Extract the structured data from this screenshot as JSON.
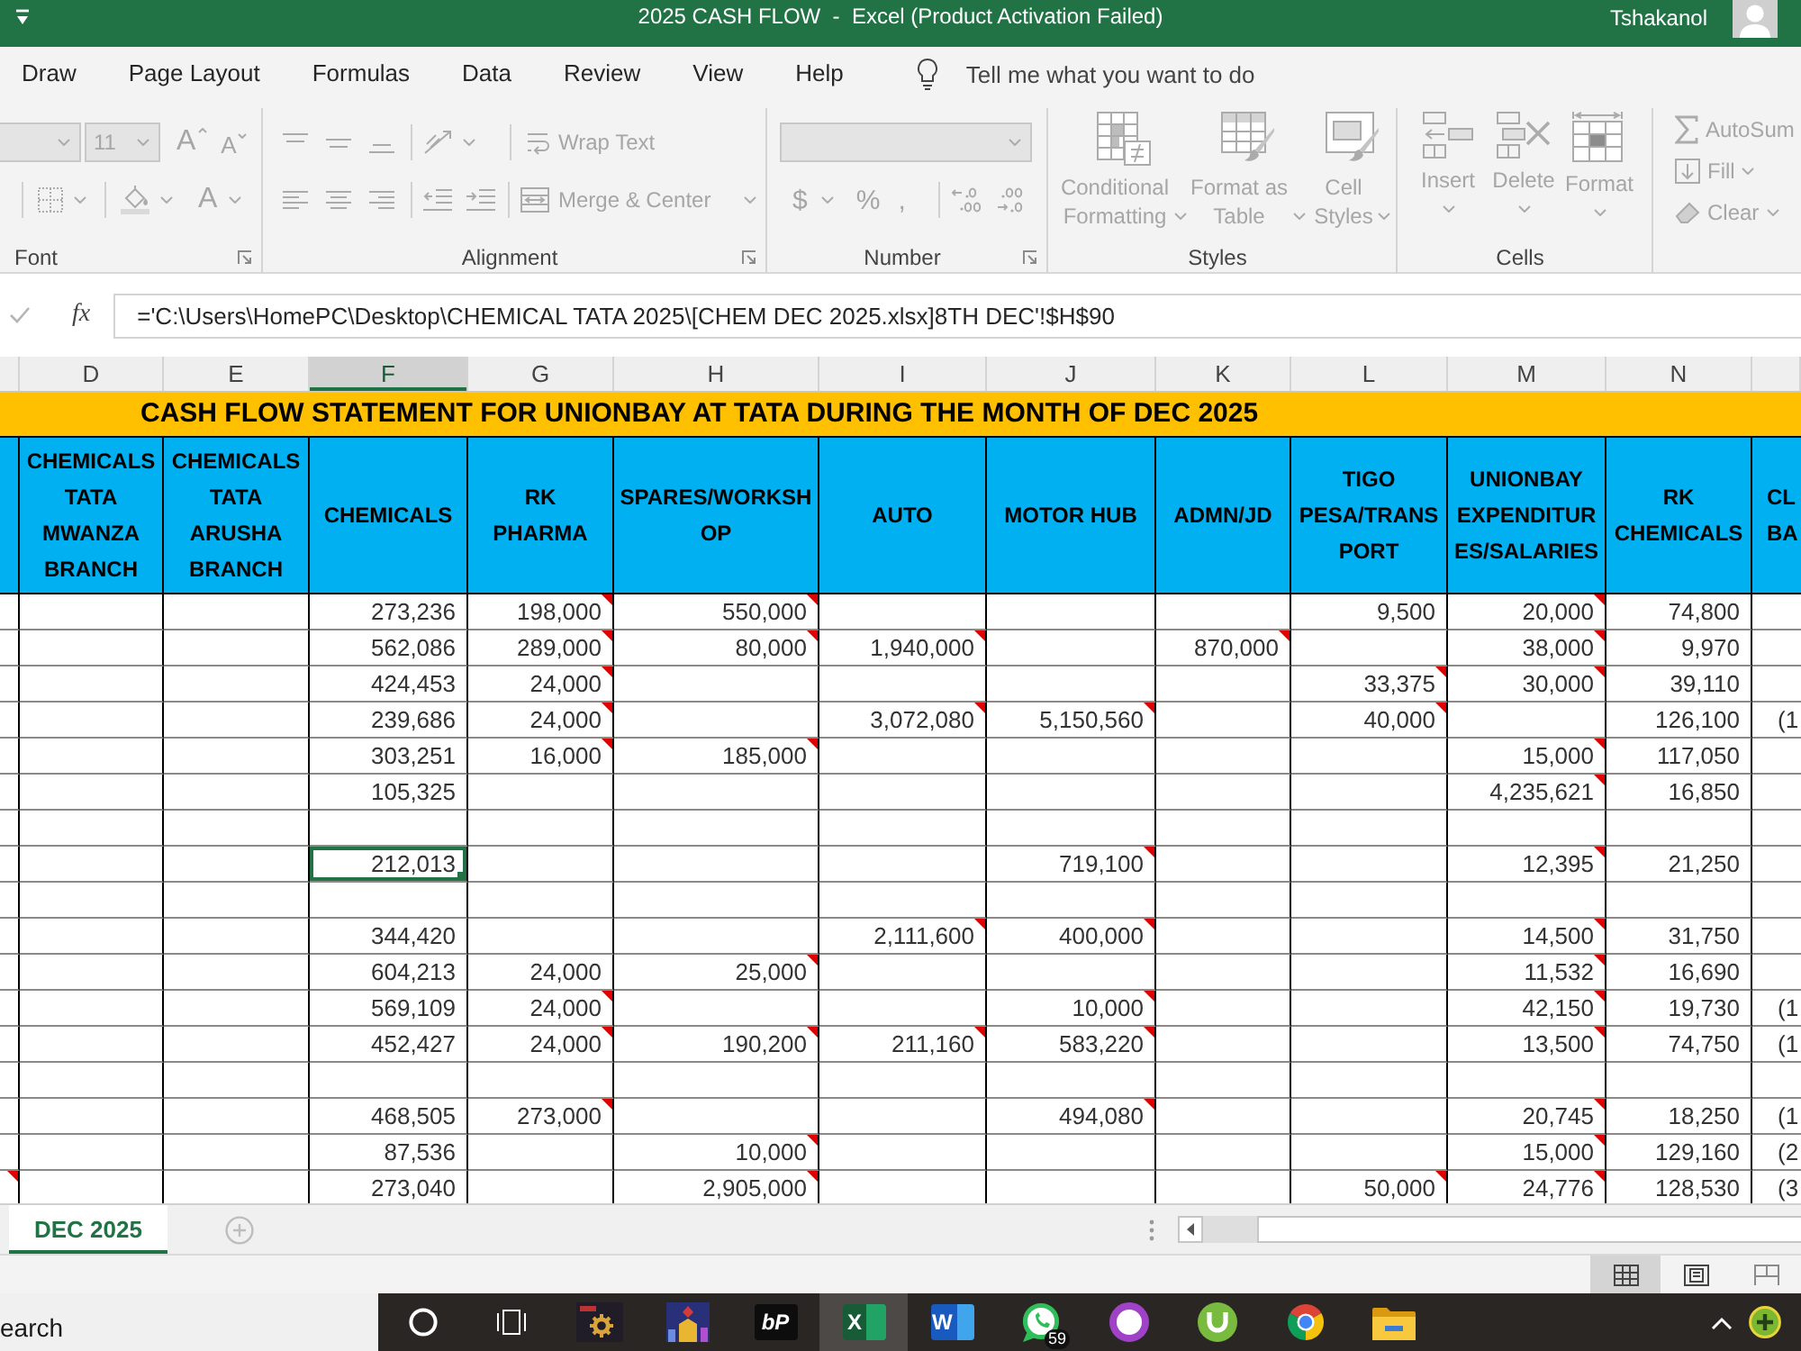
{
  "title_bar": {
    "title": "2025 CASH FLOW  -  Excel (Product Activation Failed)",
    "user": "Tshakanol"
  },
  "menu_tabs": [
    {
      "label": "Draw",
      "selected": false
    },
    {
      "label": "Page Layout",
      "selected": false
    },
    {
      "label": "Formulas",
      "selected": false
    },
    {
      "label": "Data",
      "selected": false
    },
    {
      "label": "Review",
      "selected": false
    },
    {
      "label": "View",
      "selected": false
    },
    {
      "label": "Help",
      "selected": false
    }
  ],
  "tell_me": {
    "placeholder": "Tell me what you want to do"
  },
  "ribbon": {
    "disabled": true,
    "groups": [
      {
        "kind": "font",
        "label": "Font",
        "font_size": "11",
        "grow_font": "A",
        "shrink_font": "A",
        "font_color": "A"
      },
      {
        "kind": "alignment",
        "label": "Alignment",
        "wrap_text": "Wrap Text",
        "merge": "Merge & Center"
      },
      {
        "kind": "number",
        "label": "Number",
        "currency": "$",
        "percent": "%",
        "comma": ","
      },
      {
        "kind": "styles",
        "label": "Styles",
        "commands": [
          "Conditional\nFormatting",
          "Format as\nTable",
          "Cell\nStyles"
        ]
      },
      {
        "kind": "cells",
        "label": "Cells",
        "commands": [
          "Insert",
          "Delete",
          "Format"
        ]
      },
      {
        "kind": "editing",
        "commands": [
          "AutoSum",
          "Fill",
          "Clear"
        ]
      }
    ]
  },
  "formula_bar": {
    "function_button": "fx",
    "formula": "='C:\\Users\\HomePC\\Desktop\\CHEMICAL TATA 2025\\[CHEM DEC 2025.xlsx]8TH DEC'!$H$90"
  },
  "sheet": {
    "columns": [
      {
        "selected": false
      },
      {
        "letter": "D",
        "heading": "CHEMICALS\nTATA\nMWANZA\nBRANCH",
        "selected": false
      },
      {
        "letter": "E",
        "heading": "CHEMICALS\nTATA\nARUSHA\nBRANCH",
        "selected": false
      },
      {
        "letter": "F",
        "heading": "CHEMICALS",
        "selected": true
      },
      {
        "letter": "G",
        "heading": "RK\nPHARMA",
        "selected": false
      },
      {
        "letter": "H",
        "heading": "SPARES/WORKSH\nOP",
        "selected": false
      },
      {
        "letter": "I",
        "heading": "AUTO",
        "selected": false
      },
      {
        "letter": "J",
        "heading": "MOTOR HUB",
        "selected": false
      },
      {
        "letter": "K",
        "heading": "ADMN/JD",
        "selected": false
      },
      {
        "letter": "L",
        "heading": "TIGO\nPESA/TRANS\nPORT",
        "selected": false
      },
      {
        "letter": "M",
        "heading": "UNIONBAY\nEXPENDITUR\nES/SALARIES",
        "selected": false
      },
      {
        "letter": "N",
        "heading": "RK\nCHEMICALS",
        "selected": false
      },
      {
        "heading": "CL\nBA",
        "selected": false
      }
    ],
    "title": "CASH FLOW STATEMENT FOR UNIONBAY AT TATA DURING THE MONTH OF DEC 2025",
    "rows": [
      {
        "cells": [
          {
            "comment": false,
            "selected": false
          },
          {
            "comment": false,
            "selected": false
          },
          {
            "comment": false,
            "selected": false
          },
          {
            "value": "273,236",
            "comment": false,
            "selected": false
          },
          {
            "value": "198,000",
            "comment": true,
            "selected": false
          },
          {
            "value": "550,000",
            "comment": true,
            "selected": false
          },
          {
            "comment": false,
            "selected": false
          },
          {
            "comment": false,
            "selected": false
          },
          {
            "comment": false,
            "selected": false
          },
          {
            "value": "9,500",
            "comment": false,
            "selected": false
          },
          {
            "value": "20,000",
            "comment": true,
            "selected": false
          },
          {
            "value": "74,800",
            "comment": false,
            "selected": false
          },
          {
            "comment": false,
            "selected": false
          }
        ]
      },
      {
        "cells": [
          {
            "comment": false,
            "selected": false
          },
          {
            "comment": false,
            "selected": false
          },
          {
            "comment": false,
            "selected": false
          },
          {
            "value": "562,086",
            "comment": false,
            "selected": false
          },
          {
            "value": "289,000",
            "comment": true,
            "selected": false
          },
          {
            "value": "80,000",
            "comment": true,
            "selected": false
          },
          {
            "value": "1,940,000",
            "comment": true,
            "selected": false
          },
          {
            "comment": false,
            "selected": false
          },
          {
            "value": "870,000",
            "comment": true,
            "selected": false
          },
          {
            "comment": false,
            "selected": false
          },
          {
            "value": "38,000",
            "comment": true,
            "selected": false
          },
          {
            "value": "9,970",
            "comment": false,
            "selected": false
          },
          {
            "comment": false,
            "selected": false
          }
        ]
      },
      {
        "cells": [
          {
            "comment": false,
            "selected": false
          },
          {
            "comment": false,
            "selected": false
          },
          {
            "comment": false,
            "selected": false
          },
          {
            "value": "424,453",
            "comment": false,
            "selected": false
          },
          {
            "value": "24,000",
            "comment": true,
            "selected": false
          },
          {
            "comment": false,
            "selected": false
          },
          {
            "comment": false,
            "selected": false
          },
          {
            "comment": false,
            "selected": false
          },
          {
            "comment": false,
            "selected": false
          },
          {
            "value": "33,375",
            "comment": true,
            "selected": false
          },
          {
            "value": "30,000",
            "comment": true,
            "selected": false
          },
          {
            "value": "39,110",
            "comment": false,
            "selected": false
          },
          {
            "comment": false,
            "selected": false
          }
        ]
      },
      {
        "cells": [
          {
            "comment": false,
            "selected": false
          },
          {
            "comment": false,
            "selected": false
          },
          {
            "comment": false,
            "selected": false
          },
          {
            "value": "239,686",
            "comment": false,
            "selected": false
          },
          {
            "value": "24,000",
            "comment": true,
            "selected": false
          },
          {
            "comment": false,
            "selected": false
          },
          {
            "value": "3,072,080",
            "comment": true,
            "selected": false
          },
          {
            "value": "5,150,560",
            "comment": true,
            "selected": false
          },
          {
            "comment": false,
            "selected": false
          },
          {
            "value": "40,000",
            "comment": true,
            "selected": false
          },
          {
            "comment": false,
            "selected": false
          },
          {
            "value": "126,100",
            "comment": false,
            "selected": false
          },
          {
            "value": "(1",
            "comment": false,
            "selected": false
          }
        ]
      },
      {
        "cells": [
          {
            "comment": false,
            "selected": false
          },
          {
            "comment": false,
            "selected": false
          },
          {
            "comment": false,
            "selected": false
          },
          {
            "value": "303,251",
            "comment": false,
            "selected": false
          },
          {
            "value": "16,000",
            "comment": true,
            "selected": false
          },
          {
            "value": "185,000",
            "comment": true,
            "selected": false
          },
          {
            "comment": false,
            "selected": false
          },
          {
            "comment": false,
            "selected": false
          },
          {
            "comment": false,
            "selected": false
          },
          {
            "comment": false,
            "selected": false
          },
          {
            "value": "15,000",
            "comment": true,
            "selected": false
          },
          {
            "value": "117,050",
            "comment": false,
            "selected": false
          },
          {
            "comment": false,
            "selected": false
          }
        ]
      },
      {
        "cells": [
          {
            "comment": false,
            "selected": false
          },
          {
            "comment": false,
            "selected": false
          },
          {
            "comment": false,
            "selected": false
          },
          {
            "value": "105,325",
            "comment": false,
            "selected": false
          },
          {
            "comment": false,
            "selected": false
          },
          {
            "comment": false,
            "selected": false
          },
          {
            "comment": false,
            "selected": false
          },
          {
            "comment": false,
            "selected": false
          },
          {
            "comment": false,
            "selected": false
          },
          {
            "comment": false,
            "selected": false
          },
          {
            "value": "4,235,621",
            "comment": true,
            "selected": false
          },
          {
            "value": "16,850",
            "comment": false,
            "selected": false
          },
          {
            "comment": false,
            "selected": false
          }
        ]
      },
      {
        "cells": [
          {
            "comment": false,
            "selected": false
          },
          {
            "comment": false,
            "selected": false
          },
          {
            "comment": false,
            "selected": false
          },
          {
            "comment": false,
            "selected": false
          },
          {
            "comment": false,
            "selected": false
          },
          {
            "comment": false,
            "selected": false
          },
          {
            "comment": false,
            "selected": false
          },
          {
            "comment": false,
            "selected": false
          },
          {
            "comment": false,
            "selected": false
          },
          {
            "comment": false,
            "selected": false
          },
          {
            "comment": false,
            "selected": false
          },
          {
            "comment": false,
            "selected": false
          },
          {
            "comment": false,
            "selected": false
          }
        ]
      },
      {
        "cells": [
          {
            "comment": false,
            "selected": false
          },
          {
            "comment": false,
            "selected": false
          },
          {
            "comment": false,
            "selected": false
          },
          {
            "value": "212,013",
            "comment": false,
            "selected": true
          },
          {
            "comment": false,
            "selected": false
          },
          {
            "comment": false,
            "selected": false
          },
          {
            "comment": false,
            "selected": false
          },
          {
            "value": "719,100",
            "comment": true,
            "selected": false
          },
          {
            "comment": false,
            "selected": false
          },
          {
            "comment": false,
            "selected": false
          },
          {
            "value": "12,395",
            "comment": true,
            "selected": false
          },
          {
            "value": "21,250",
            "comment": false,
            "selected": false
          },
          {
            "comment": false,
            "selected": false
          }
        ]
      },
      {
        "cells": [
          {
            "comment": false,
            "selected": false
          },
          {
            "comment": false,
            "selected": false
          },
          {
            "comment": false,
            "selected": false
          },
          {
            "comment": false,
            "selected": false
          },
          {
            "comment": false,
            "selected": false
          },
          {
            "comment": false,
            "selected": false
          },
          {
            "comment": false,
            "selected": false
          },
          {
            "comment": false,
            "selected": false
          },
          {
            "comment": false,
            "selected": false
          },
          {
            "comment": false,
            "selected": false
          },
          {
            "comment": false,
            "selected": false
          },
          {
            "comment": false,
            "selected": false
          },
          {
            "comment": false,
            "selected": false
          }
        ]
      },
      {
        "cells": [
          {
            "comment": false,
            "selected": false
          },
          {
            "comment": false,
            "selected": false
          },
          {
            "comment": false,
            "selected": false
          },
          {
            "value": "344,420",
            "comment": false,
            "selected": false
          },
          {
            "comment": false,
            "selected": false
          },
          {
            "comment": false,
            "selected": false
          },
          {
            "value": "2,111,600",
            "comment": true,
            "selected": false
          },
          {
            "value": "400,000",
            "comment": true,
            "selected": false
          },
          {
            "comment": false,
            "selected": false
          },
          {
            "comment": false,
            "selected": false
          },
          {
            "value": "14,500",
            "comment": true,
            "selected": false
          },
          {
            "value": "31,750",
            "comment": false,
            "selected": false
          },
          {
            "comment": false,
            "selected": false
          }
        ]
      },
      {
        "cells": [
          {
            "comment": false,
            "selected": false
          },
          {
            "comment": false,
            "selected": false
          },
          {
            "comment": false,
            "selected": false
          },
          {
            "value": "604,213",
            "comment": false,
            "selected": false
          },
          {
            "value": "24,000",
            "comment": false,
            "selected": false
          },
          {
            "value": "25,000",
            "comment": true,
            "selected": false
          },
          {
            "comment": false,
            "selected": false
          },
          {
            "comment": false,
            "selected": false
          },
          {
            "comment": false,
            "selected": false
          },
          {
            "comment": false,
            "selected": false
          },
          {
            "value": "11,532",
            "comment": true,
            "selected": false
          },
          {
            "value": "16,690",
            "comment": false,
            "selected": false
          },
          {
            "comment": false,
            "selected": false
          }
        ]
      },
      {
        "cells": [
          {
            "comment": false,
            "selected": false
          },
          {
            "comment": false,
            "selected": false
          },
          {
            "comment": false,
            "selected": false
          },
          {
            "value": "569,109",
            "comment": false,
            "selected": false
          },
          {
            "value": "24,000",
            "comment": true,
            "selected": false
          },
          {
            "comment": false,
            "selected": false
          },
          {
            "comment": false,
            "selected": false
          },
          {
            "value": "10,000",
            "comment": true,
            "selected": false
          },
          {
            "comment": false,
            "selected": false
          },
          {
            "comment": false,
            "selected": false
          },
          {
            "value": "42,150",
            "comment": true,
            "selected": false
          },
          {
            "value": "19,730",
            "comment": false,
            "selected": false
          },
          {
            "value": "(1",
            "comment": false,
            "selected": false
          }
        ]
      },
      {
        "cells": [
          {
            "comment": false,
            "selected": false
          },
          {
            "comment": false,
            "selected": false
          },
          {
            "comment": false,
            "selected": false
          },
          {
            "value": "452,427",
            "comment": false,
            "selected": false
          },
          {
            "value": "24,000",
            "comment": true,
            "selected": false
          },
          {
            "value": "190,200",
            "comment": true,
            "selected": false
          },
          {
            "value": "211,160",
            "comment": true,
            "selected": false
          },
          {
            "value": "583,220",
            "comment": true,
            "selected": false
          },
          {
            "comment": false,
            "selected": false
          },
          {
            "comment": false,
            "selected": false
          },
          {
            "value": "13,500",
            "comment": true,
            "selected": false
          },
          {
            "value": "74,750",
            "comment": false,
            "selected": false
          },
          {
            "value": "(1",
            "comment": false,
            "selected": false
          }
        ]
      },
      {
        "cells": [
          {
            "comment": false,
            "selected": false
          },
          {
            "comment": false,
            "selected": false
          },
          {
            "comment": false,
            "selected": false
          },
          {
            "comment": false,
            "selected": false
          },
          {
            "comment": false,
            "selected": false
          },
          {
            "comment": false,
            "selected": false
          },
          {
            "comment": false,
            "selected": false
          },
          {
            "comment": false,
            "selected": false
          },
          {
            "comment": false,
            "selected": false
          },
          {
            "comment": false,
            "selected": false
          },
          {
            "comment": false,
            "selected": false
          },
          {
            "comment": false,
            "selected": false
          },
          {
            "comment": false,
            "selected": false
          }
        ]
      },
      {
        "cells": [
          {
            "comment": false,
            "selected": false
          },
          {
            "comment": false,
            "selected": false
          },
          {
            "comment": false,
            "selected": false
          },
          {
            "value": "468,505",
            "comment": false,
            "selected": false
          },
          {
            "value": "273,000",
            "comment": true,
            "selected": false
          },
          {
            "comment": false,
            "selected": false
          },
          {
            "comment": false,
            "selected": false
          },
          {
            "value": "494,080",
            "comment": true,
            "selected": false
          },
          {
            "comment": false,
            "selected": false
          },
          {
            "comment": false,
            "selected": false
          },
          {
            "value": "20,745",
            "comment": true,
            "selected": false
          },
          {
            "value": "18,250",
            "comment": false,
            "selected": false
          },
          {
            "value": "(1",
            "comment": false,
            "selected": false
          }
        ]
      },
      {
        "cells": [
          {
            "comment": false,
            "selected": false
          },
          {
            "comment": false,
            "selected": false
          },
          {
            "comment": false,
            "selected": false
          },
          {
            "value": "87,536",
            "comment": false,
            "selected": false
          },
          {
            "comment": false,
            "selected": false
          },
          {
            "value": "10,000",
            "comment": true,
            "selected": false
          },
          {
            "comment": false,
            "selected": false
          },
          {
            "comment": false,
            "selected": false
          },
          {
            "comment": false,
            "selected": false
          },
          {
            "comment": false,
            "selected": false
          },
          {
            "value": "15,000",
            "comment": true,
            "selected": false
          },
          {
            "value": "129,160",
            "comment": false,
            "selected": false
          },
          {
            "value": "(2",
            "comment": false,
            "selected": false
          }
        ]
      },
      {
        "cells": [
          {
            "comment": true,
            "selected": false
          },
          {
            "comment": false,
            "selected": false
          },
          {
            "comment": false,
            "selected": false
          },
          {
            "value": "273,040",
            "comment": false,
            "selected": false
          },
          {
            "comment": false,
            "selected": false
          },
          {
            "value": "2,905,000",
            "comment": true,
            "selected": false
          },
          {
            "comment": false,
            "selected": false
          },
          {
            "comment": false,
            "selected": false
          },
          {
            "comment": false,
            "selected": false
          },
          {
            "value": "50,000",
            "comment": true,
            "selected": false
          },
          {
            "value": "24,776",
            "comment": true,
            "selected": false
          },
          {
            "value": "128,530",
            "comment": false,
            "selected": false
          },
          {
            "value": "(3",
            "comment": false,
            "selected": false
          }
        ]
      }
    ]
  },
  "sheet_tabs": [
    {
      "label": "DEC 2025",
      "selected": true
    }
  ],
  "status_bar": {
    "views": [
      {
        "kind": "normal",
        "selected": true
      },
      {
        "kind": "page_layout",
        "selected": false
      },
      {
        "kind": "page_break",
        "selected": false
      }
    ]
  },
  "taskbar": {
    "search": {
      "placeholder": "earch"
    },
    "apps": [
      {
        "kind": "cortana",
        "selected": false
      },
      {
        "kind": "task_view",
        "selected": false
      },
      {
        "kind": "gear_game",
        "selected": false
      },
      {
        "kind": "game_art",
        "selected": false
      },
      {
        "kind": "bp",
        "label": "bP",
        "selected": false
      },
      {
        "kind": "excel",
        "label": "X",
        "selected": true
      },
      {
        "kind": "word",
        "label": "W",
        "selected": false
      },
      {
        "kind": "whatsapp",
        "badge": "59",
        "selected": false
      },
      {
        "kind": "ring",
        "selected": false
      },
      {
        "kind": "utorrent",
        "selected": false
      },
      {
        "kind": "chrome",
        "selected": false
      },
      {
        "kind": "explorer",
        "selected": false
      }
    ]
  }
}
